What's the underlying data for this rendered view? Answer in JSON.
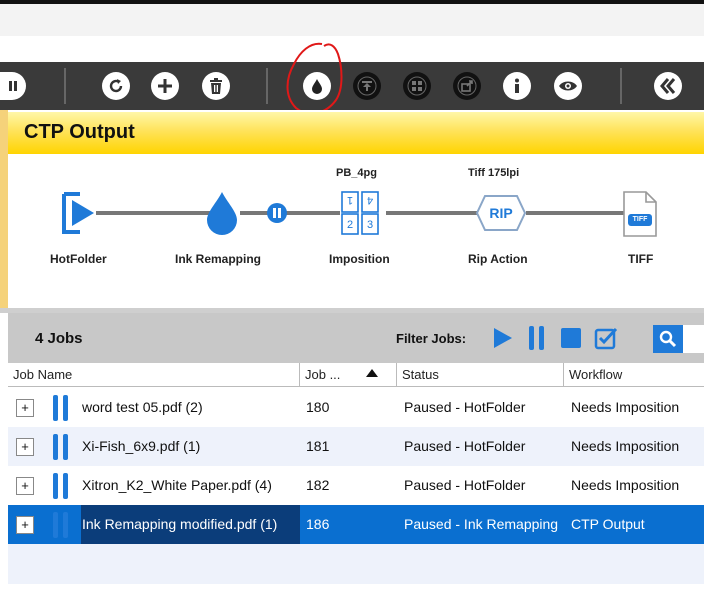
{
  "panel": {
    "title": "CTP Output"
  },
  "workflow": {
    "nodes": [
      {
        "label": "HotFolder",
        "sub": ""
      },
      {
        "label": "Ink Remapping",
        "sub": ""
      },
      {
        "label": "Imposition",
        "sub": "PB_4pg"
      },
      {
        "label": "Rip Action",
        "sub": "Tiff 175lpi"
      },
      {
        "label": "TIFF",
        "sub": ""
      }
    ],
    "rip_text": "RIP",
    "tiff_text": "TIFF"
  },
  "jobs_panel": {
    "count_label": "4 Jobs",
    "filter_label": "Filter Jobs:"
  },
  "table": {
    "columns": [
      "Job Name",
      "Job ...",
      "Status",
      "Workflow"
    ],
    "rows": [
      {
        "name": "word test 05.pdf (2)",
        "job": "180",
        "status": "Paused - HotFolder",
        "workflow": "Needs Imposition"
      },
      {
        "name": "Xi-Fish_6x9.pdf (1)",
        "job": "181",
        "status": "Paused - HotFolder",
        "workflow": "Needs Imposition"
      },
      {
        "name": "Xitron_K2_White Paper.pdf (4)",
        "job": "182",
        "status": "Paused - HotFolder",
        "workflow": "Needs Imposition"
      },
      {
        "name": "Ink Remapping modified.pdf (1)",
        "job": "186",
        "status": "Paused - Ink Remapping",
        "workflow": "CTP Output"
      }
    ]
  },
  "colors": {
    "accent": "#1f7ad8",
    "header_yellow": "#ffd400",
    "selection": "#0a6fd0"
  }
}
